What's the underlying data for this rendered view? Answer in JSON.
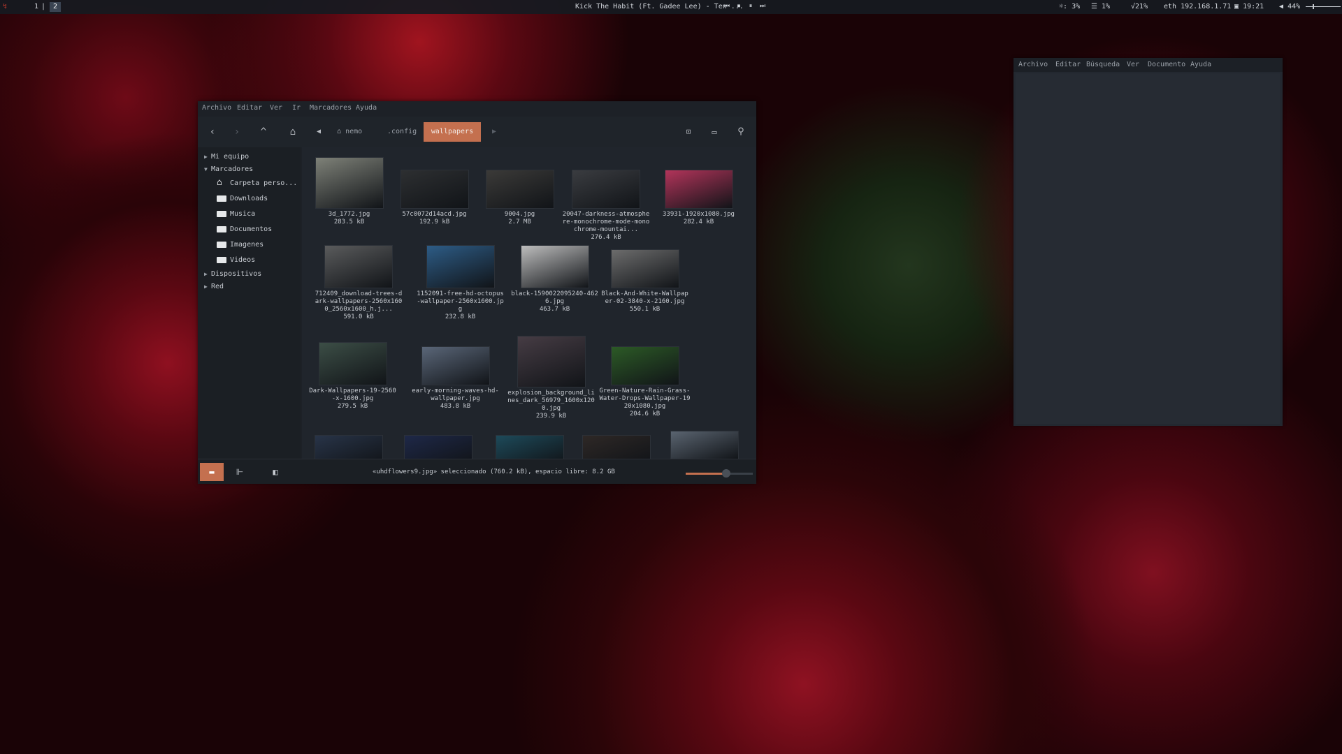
{
  "topbar": {
    "workspaces": [
      "1",
      "|",
      "2"
    ],
    "now_playing": "Kick The Habit (Ft. Gadee Lee) - Ten ...",
    "media": {
      "prev": "⏮",
      "stop": "⏹",
      "pause": "⏸",
      "next": "⏭"
    },
    "tray": {
      "brightness": "3%",
      "disk": "1%",
      "cpu": "21%",
      "network": "eth 192.168.1.71",
      "time": "19:21",
      "volume": "44%"
    }
  },
  "file_manager": {
    "menu": [
      "Archivo",
      "Editar",
      "Ver",
      "Ir",
      "Marcadores",
      "Ayuda"
    ],
    "breadcrumb": [
      "nemo",
      ".config",
      "wallpapers"
    ],
    "sidebar": {
      "mi_equipo": "Mi equipo",
      "marcadores": "Marcadores",
      "items": [
        "Carpeta perso...",
        "Downloads",
        "Musica",
        "Documentos",
        "Imagenes",
        "Videos"
      ],
      "dispositivos": "Dispositivos",
      "red": "Red"
    },
    "files": [
      {
        "name": "3d_1772.jpg",
        "size": "283.5 kB",
        "tone": "#7e8178"
      },
      {
        "name": "57c0072d14acd.jpg",
        "size": "192.9 kB",
        "tone": "#2d2f31"
      },
      {
        "name": "9004.jpg",
        "size": "2.7 MB",
        "tone": "#3b3a38"
      },
      {
        "name": "20047-darkness-atmosphere-monochrome-mode-monochrome-mountai...",
        "size": "276.4 kB",
        "tone": "#3a3c40"
      },
      {
        "name": "33931-1920x1080.jpg",
        "size": "282.4 kB",
        "tone": "#b2345a"
      },
      {
        "name": "712409_download-trees-dark-wallpapers-2560x1600_2560x1600_h.j...",
        "size": "591.0 kB",
        "tone": "#5a5b5c"
      },
      {
        "name": "1152091-free-hd-octopus-wallpaper-2560x1600.jpg",
        "size": "232.8 kB",
        "tone": "#2d5c86"
      },
      {
        "name": "black-1590022095240-4626.jpg",
        "size": "463.7 kB",
        "tone": "#bdbdbd"
      },
      {
        "name": "Black-And-White-Wallpaper-02-3840-x-2160.jpg",
        "size": "550.1 kB",
        "tone": "#6c6c6c"
      },
      {
        "name": "Dark-Wallpapers-19-2560-x-1600.jpg",
        "size": "279.5 kB",
        "tone": "#3c4e46"
      },
      {
        "name": "early-morning-waves-hd-wallpaper.jpg",
        "size": "483.8 kB",
        "tone": "#5a6678"
      },
      {
        "name": "explosion_background_lines_dark_56979_1600x1200.jpg",
        "size": "239.9 kB",
        "tone": "#463c44"
      },
      {
        "name": "Green-Nature-Rain-Grass-Water-Drops-Wallpaper-1920x1080.jpg",
        "size": "204.6 kB",
        "tone": "#2c5a26"
      }
    ],
    "partial_row_tones": [
      "#283448",
      "#1e2848",
      "#1d4a5a",
      "#2e2826",
      "#5a6470"
    ],
    "status": "«uhdflowers9.jpg» seleccionado (760.2 kB), espacio libre: 8.2 GB",
    "zoom_fraction": 0.6,
    "accent": "#c4704f"
  },
  "editor": {
    "menu": [
      "Archivo",
      "Editar",
      "Búsqueda",
      "Ver",
      "Documento",
      "Ayuda"
    ]
  }
}
